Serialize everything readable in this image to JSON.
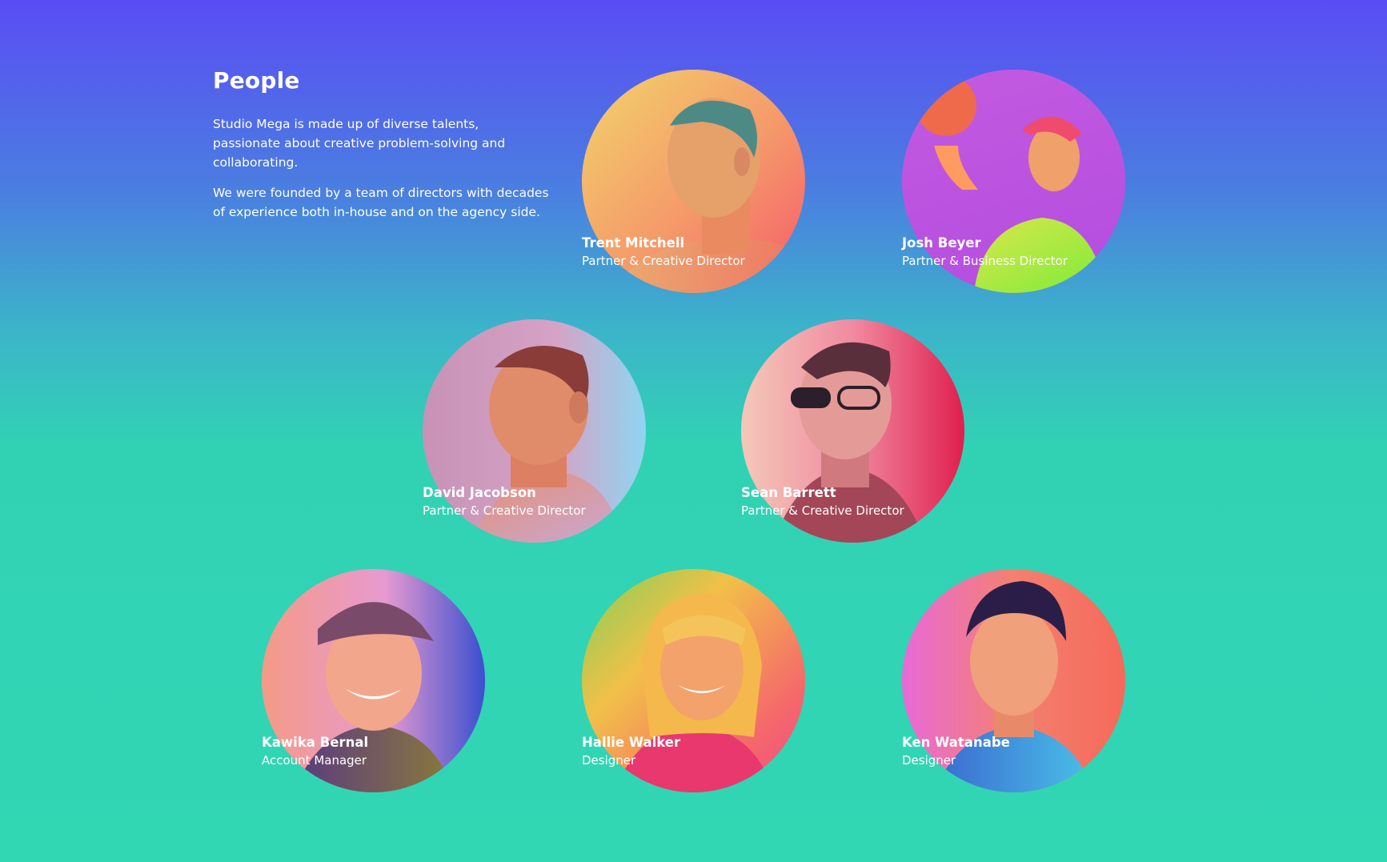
{
  "section": {
    "title": "People",
    "paragraphs": [
      "Studio Mega is made up of diverse talents, passionate about creative problem-solving and collaborating.",
      "We were founded by a team of directors with decades of experience both in-house and on the agency side."
    ]
  },
  "people": [
    {
      "name": "Trent Mitchell",
      "role": "Partner & Creative Director"
    },
    {
      "name": "Josh Beyer",
      "role": "Partner & Business Director"
    },
    {
      "name": "David Jacobson",
      "role": "Partner & Creative Director"
    },
    {
      "name": "Sean Barrett",
      "role": "Partner & Creative Director"
    },
    {
      "name": "Kawika Bernal",
      "role": "Account Manager"
    },
    {
      "name": "Hallie Walker",
      "role": "Designer"
    },
    {
      "name": "Ken Watanabe",
      "role": "Designer"
    }
  ],
  "colors": {
    "background_top": "#5a4cf4",
    "background_bottom": "#31d6b3",
    "text": "#ffffff"
  }
}
